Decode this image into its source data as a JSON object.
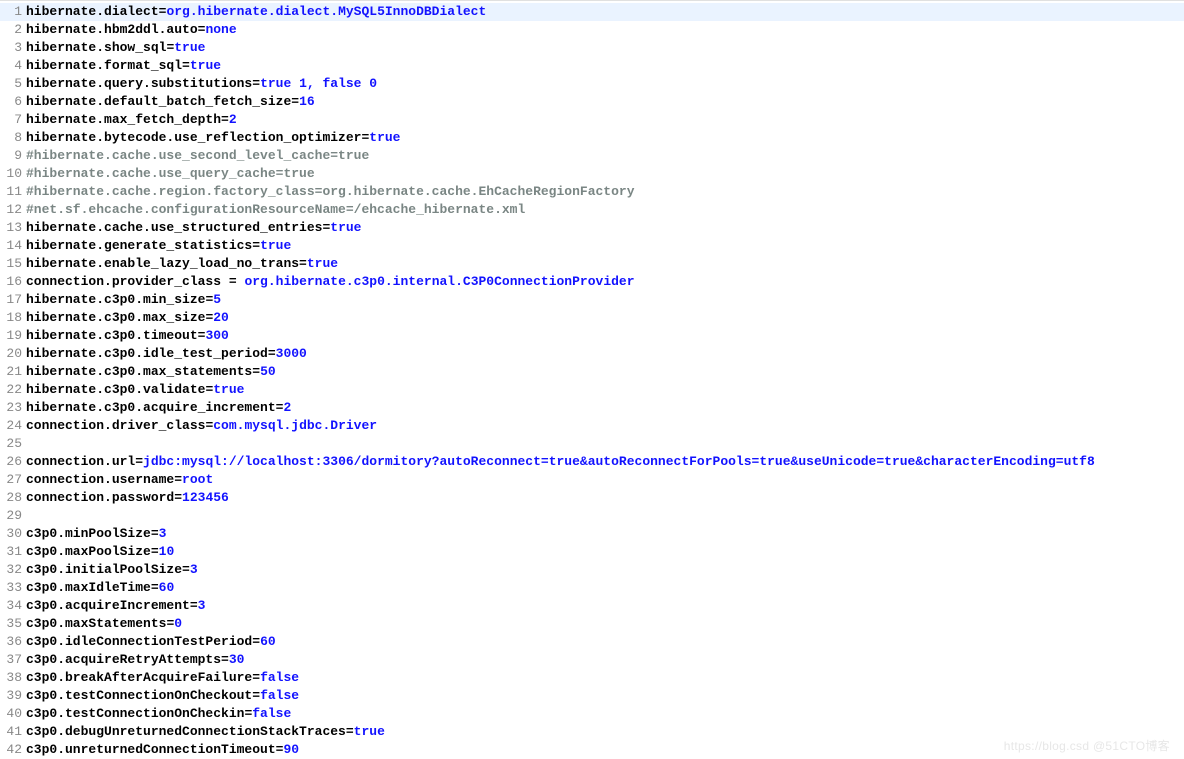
{
  "watermark": "https://blog.csd @51CTO博客",
  "lines": [
    {
      "n": 1,
      "current": true,
      "segs": [
        {
          "t": "hibernate.dialect",
          "c": "k"
        },
        {
          "t": "=",
          "c": "eq"
        },
        {
          "t": "org.hibernate.dialect.MySQL5InnoDBDialect",
          "c": "v"
        }
      ]
    },
    {
      "n": 2,
      "segs": [
        {
          "t": "hibernate.hbm2ddl.auto",
          "c": "k"
        },
        {
          "t": "=",
          "c": "eq"
        },
        {
          "t": "none",
          "c": "v"
        }
      ]
    },
    {
      "n": 3,
      "segs": [
        {
          "t": "hibernate.show_sql",
          "c": "k"
        },
        {
          "t": "=",
          "c": "eq"
        },
        {
          "t": "true",
          "c": "v"
        }
      ]
    },
    {
      "n": 4,
      "segs": [
        {
          "t": "hibernate.format_sql",
          "c": "k"
        },
        {
          "t": "=",
          "c": "eq"
        },
        {
          "t": "true",
          "c": "v"
        }
      ]
    },
    {
      "n": 5,
      "segs": [
        {
          "t": "hibernate.query.substitutions",
          "c": "k"
        },
        {
          "t": "=",
          "c": "eq"
        },
        {
          "t": "true 1, false 0",
          "c": "v"
        }
      ]
    },
    {
      "n": 6,
      "segs": [
        {
          "t": "hibernate.default_batch_fetch_size",
          "c": "k"
        },
        {
          "t": "=",
          "c": "eq"
        },
        {
          "t": "16",
          "c": "v"
        }
      ]
    },
    {
      "n": 7,
      "segs": [
        {
          "t": "hibernate.max_fetch_depth",
          "c": "k"
        },
        {
          "t": "=",
          "c": "eq"
        },
        {
          "t": "2",
          "c": "v"
        }
      ]
    },
    {
      "n": 8,
      "segs": [
        {
          "t": "hibernate.bytecode.use_reflection_optimizer",
          "c": "k"
        },
        {
          "t": "=",
          "c": "eq"
        },
        {
          "t": "true",
          "c": "v"
        }
      ]
    },
    {
      "n": 9,
      "segs": [
        {
          "t": "#hibernate.cache.use_second_level_cache=true",
          "c": "c"
        }
      ]
    },
    {
      "n": 10,
      "segs": [
        {
          "t": "#hibernate.cache.use_query_cache=true",
          "c": "c"
        }
      ]
    },
    {
      "n": 11,
      "segs": [
        {
          "t": "#hibernate.cache.region.factory_class=org.hibernate.cache.EhCacheRegionFactory",
          "c": "c"
        }
      ]
    },
    {
      "n": 12,
      "segs": [
        {
          "t": "#net.sf.ehcache.configurationResourceName=/ehcache_hibernate.xml",
          "c": "c"
        }
      ]
    },
    {
      "n": 13,
      "segs": [
        {
          "t": "hibernate.cache.use_structured_entries",
          "c": "k"
        },
        {
          "t": "=",
          "c": "eq"
        },
        {
          "t": "true",
          "c": "v"
        }
      ]
    },
    {
      "n": 14,
      "segs": [
        {
          "t": "hibernate.generate_statistics",
          "c": "k"
        },
        {
          "t": "=",
          "c": "eq"
        },
        {
          "t": "true",
          "c": "v"
        }
      ]
    },
    {
      "n": 15,
      "segs": [
        {
          "t": "hibernate.enable_lazy_load_no_trans",
          "c": "k"
        },
        {
          "t": "=",
          "c": "eq"
        },
        {
          "t": "true",
          "c": "v"
        }
      ]
    },
    {
      "n": 16,
      "segs": [
        {
          "t": "connection.provider_class ",
          "c": "k"
        },
        {
          "t": "=",
          "c": "eq"
        },
        {
          "t": " org.hibernate.c3p0.internal.C3P0ConnectionProvider",
          "c": "v"
        }
      ]
    },
    {
      "n": 17,
      "segs": [
        {
          "t": "hibernate.c3p0.min_size",
          "c": "k"
        },
        {
          "t": "=",
          "c": "eq"
        },
        {
          "t": "5",
          "c": "v"
        }
      ]
    },
    {
      "n": 18,
      "segs": [
        {
          "t": "hibernate.c3p0.max_size",
          "c": "k"
        },
        {
          "t": "=",
          "c": "eq"
        },
        {
          "t": "20",
          "c": "v"
        }
      ]
    },
    {
      "n": 19,
      "segs": [
        {
          "t": "hibernate.c3p0.timeout",
          "c": "k"
        },
        {
          "t": "=",
          "c": "eq"
        },
        {
          "t": "300",
          "c": "v"
        }
      ]
    },
    {
      "n": 20,
      "segs": [
        {
          "t": "hibernate.c3p0.idle_test_period",
          "c": "k"
        },
        {
          "t": "=",
          "c": "eq"
        },
        {
          "t": "3000",
          "c": "v"
        }
      ]
    },
    {
      "n": 21,
      "segs": [
        {
          "t": "hibernate.c3p0.max_statements",
          "c": "k"
        },
        {
          "t": "=",
          "c": "eq"
        },
        {
          "t": "50",
          "c": "v"
        }
      ]
    },
    {
      "n": 22,
      "segs": [
        {
          "t": "hibernate.c3p0.validate",
          "c": "k"
        },
        {
          "t": "=",
          "c": "eq"
        },
        {
          "t": "true",
          "c": "v"
        }
      ]
    },
    {
      "n": 23,
      "segs": [
        {
          "t": "hibernate.c3p0.acquire_increment",
          "c": "k"
        },
        {
          "t": "=",
          "c": "eq"
        },
        {
          "t": "2",
          "c": "v"
        }
      ]
    },
    {
      "n": 24,
      "segs": [
        {
          "t": "connection.driver_class",
          "c": "k"
        },
        {
          "t": "=",
          "c": "eq"
        },
        {
          "t": "com.mysql.jdbc.Driver",
          "c": "v"
        }
      ]
    },
    {
      "n": 25,
      "segs": []
    },
    {
      "n": 26,
      "segs": [
        {
          "t": "connection.url",
          "c": "k"
        },
        {
          "t": "=",
          "c": "eq"
        },
        {
          "t": "jdbc:mysql://localhost:3306/dormitory?autoReconnect=true&autoReconnectForPools=true&useUnicode=true&characterEncoding=utf8",
          "c": "v"
        }
      ]
    },
    {
      "n": 27,
      "segs": [
        {
          "t": "connection.username",
          "c": "k"
        },
        {
          "t": "=",
          "c": "eq"
        },
        {
          "t": "root",
          "c": "v"
        }
      ]
    },
    {
      "n": 28,
      "segs": [
        {
          "t": "connection.password",
          "c": "k"
        },
        {
          "t": "=",
          "c": "eq"
        },
        {
          "t": "123456",
          "c": "v"
        }
      ]
    },
    {
      "n": 29,
      "segs": []
    },
    {
      "n": 30,
      "segs": [
        {
          "t": "c3p0.minPoolSize",
          "c": "k"
        },
        {
          "t": "=",
          "c": "eq"
        },
        {
          "t": "3",
          "c": "v"
        }
      ]
    },
    {
      "n": 31,
      "segs": [
        {
          "t": "c3p0.maxPoolSize",
          "c": "k"
        },
        {
          "t": "=",
          "c": "eq"
        },
        {
          "t": "10",
          "c": "v"
        }
      ]
    },
    {
      "n": 32,
      "segs": [
        {
          "t": "c3p0.initialPoolSize",
          "c": "k"
        },
        {
          "t": "=",
          "c": "eq"
        },
        {
          "t": "3",
          "c": "v"
        }
      ]
    },
    {
      "n": 33,
      "segs": [
        {
          "t": "c3p0.maxIdleTime",
          "c": "k"
        },
        {
          "t": "=",
          "c": "eq"
        },
        {
          "t": "60",
          "c": "v"
        }
      ]
    },
    {
      "n": 34,
      "segs": [
        {
          "t": "c3p0.acquireIncrement",
          "c": "k"
        },
        {
          "t": "=",
          "c": "eq"
        },
        {
          "t": "3",
          "c": "v"
        }
      ]
    },
    {
      "n": 35,
      "segs": [
        {
          "t": "c3p0.maxStatements",
          "c": "k"
        },
        {
          "t": "=",
          "c": "eq"
        },
        {
          "t": "0",
          "c": "v"
        }
      ]
    },
    {
      "n": 36,
      "segs": [
        {
          "t": "c3p0.idleConnectionTestPeriod",
          "c": "k"
        },
        {
          "t": "=",
          "c": "eq"
        },
        {
          "t": "60",
          "c": "v"
        }
      ]
    },
    {
      "n": 37,
      "segs": [
        {
          "t": "c3p0.acquireRetryAttempts",
          "c": "k"
        },
        {
          "t": "=",
          "c": "eq"
        },
        {
          "t": "30",
          "c": "v"
        }
      ]
    },
    {
      "n": 38,
      "segs": [
        {
          "t": "c3p0.breakAfterAcquireFailure",
          "c": "k"
        },
        {
          "t": "=",
          "c": "eq"
        },
        {
          "t": "false",
          "c": "v"
        }
      ]
    },
    {
      "n": 39,
      "segs": [
        {
          "t": "c3p0.testConnectionOnCheckout",
          "c": "k"
        },
        {
          "t": "=",
          "c": "eq"
        },
        {
          "t": "false",
          "c": "v"
        }
      ]
    },
    {
      "n": 40,
      "segs": [
        {
          "t": "c3p0.testConnectionOnCheckin",
          "c": "k"
        },
        {
          "t": "=",
          "c": "eq"
        },
        {
          "t": "false",
          "c": "v"
        }
      ]
    },
    {
      "n": 41,
      "segs": [
        {
          "t": "c3p0.debugUnreturnedConnectionStackTraces",
          "c": "k"
        },
        {
          "t": "=",
          "c": "eq"
        },
        {
          "t": "true",
          "c": "v"
        }
      ]
    },
    {
      "n": 42,
      "segs": [
        {
          "t": "c3p0.unreturnedConnectionTimeout",
          "c": "k"
        },
        {
          "t": "=",
          "c": "eq"
        },
        {
          "t": "90",
          "c": "v"
        }
      ]
    }
  ]
}
